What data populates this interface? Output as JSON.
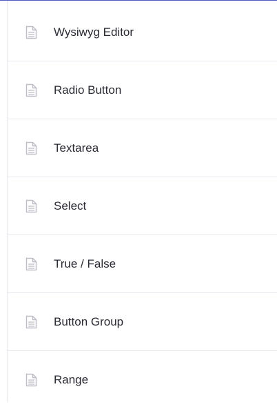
{
  "sidebar": {
    "items": [
      {
        "label": "Wysiwyg Editor",
        "icon": "document-icon"
      },
      {
        "label": "Radio Button",
        "icon": "document-icon"
      },
      {
        "label": "Textarea",
        "icon": "document-icon"
      },
      {
        "label": "Select",
        "icon": "document-icon"
      },
      {
        "label": "True / False",
        "icon": "document-icon"
      },
      {
        "label": "Button Group",
        "icon": "document-icon"
      },
      {
        "label": "Range",
        "icon": "document-icon"
      }
    ]
  },
  "colors": {
    "top_rule": "#4b5bbd",
    "divider": "#e8e8ee",
    "text": "#2a2b34",
    "icon_stroke": "#bdbdc7"
  }
}
